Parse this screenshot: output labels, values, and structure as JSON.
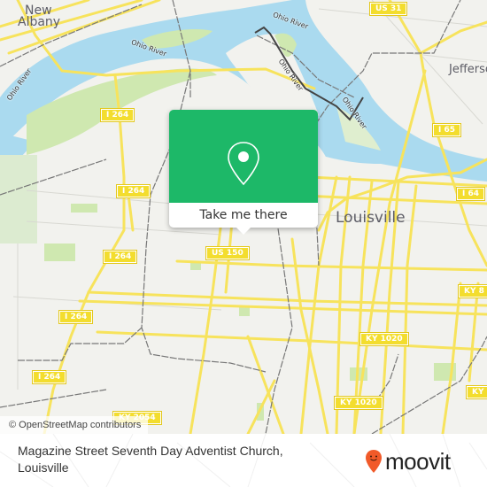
{
  "map": {
    "cities": [
      {
        "name": "New Albany",
        "line1": "New",
        "line2": "Albany"
      },
      {
        "name": "Louisville"
      },
      {
        "name": "Jeffersonville",
        "visible_text": "Jefferso"
      }
    ],
    "river_labels": [
      "Ohio River",
      "Ohio River",
      "Ohio River",
      "Ohio River",
      "Ohio River"
    ],
    "road_shields": [
      "US 31",
      "I 264",
      "I 264",
      "I 264",
      "I 264",
      "I 264",
      "I 65",
      "I 64",
      "US 150",
      "KY 1020",
      "KY 1020",
      "KY 8",
      "KY",
      "KY 2054"
    ],
    "colors": {
      "land": "#f2f2ee",
      "water": "#aadaef",
      "park": "#cfe8b0",
      "road": "#f7e35c",
      "shield": "#f3dd2e",
      "rail": "#777777",
      "accent_green": "#1db868",
      "moovit_orange": "#f15a29"
    }
  },
  "popup": {
    "icon": "map-pin-icon",
    "button_label": "Take me there"
  },
  "attribution": "© OpenStreetMap contributors",
  "footer": {
    "place_name": "Magazine Street Seventh Day Adventist Church, Louisville",
    "brand": "moovit",
    "brand_icon": "moovit-pin-smile-icon"
  }
}
